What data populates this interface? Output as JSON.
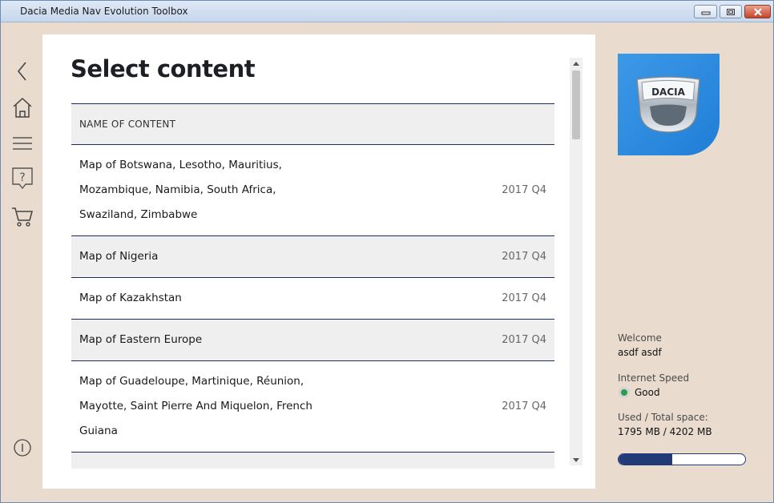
{
  "window": {
    "title": "Dacia Media Nav Evolution Toolbox"
  },
  "icons": {
    "back": "chevron-left-icon",
    "home": "home-icon",
    "menu": "menu-icon",
    "help": "help-icon",
    "cart": "cart-icon",
    "info": "info-icon"
  },
  "main": {
    "title": "Select content",
    "table": {
      "header": "NAME OF CONTENT",
      "rows": [
        {
          "lines": [
            "Map of Botswana, Lesotho, Mauritius,",
            "Mozambique, Namibia, South Africa,",
            "Swaziland, Zimbabwe"
          ],
          "version": "2017 Q4"
        },
        {
          "lines": [
            "Map of Nigeria"
          ],
          "version": "2017 Q4"
        },
        {
          "lines": [
            "Map of Kazakhstan"
          ],
          "version": "2017 Q4"
        },
        {
          "lines": [
            "Map of Eastern Europe"
          ],
          "version": "2017 Q4"
        },
        {
          "lines": [
            "Map of Guadeloupe, Martinique, Réunion,",
            "Mayotte, Saint Pierre And Miquelon, French",
            "Guiana"
          ],
          "version": "2017 Q4"
        }
      ]
    }
  },
  "side": {
    "brand": "DACIA",
    "welcome_label": "Welcome",
    "user": "asdf asdf",
    "speed_label": "Internet Speed",
    "speed_value": "Good",
    "space_label": "Used / Total space:",
    "space_value": "1795 MB / 4202 MB",
    "space_used_fraction": 0.427
  },
  "colors": {
    "accent": "#213a78",
    "background": "#e9dccf",
    "logo": "#2d8de0",
    "status_good": "#2e9a4c"
  }
}
